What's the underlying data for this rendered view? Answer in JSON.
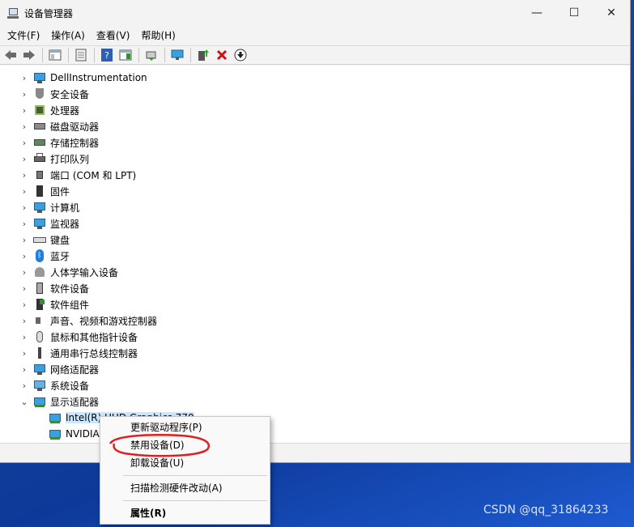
{
  "window": {
    "title": "设备管理器",
    "controls": {
      "minimize": "—",
      "maximize": "☐",
      "close": "✕"
    }
  },
  "menubar": [
    {
      "label": "文件(F)"
    },
    {
      "label": "操作(A)"
    },
    {
      "label": "查看(V)"
    },
    {
      "label": "帮助(H)"
    }
  ],
  "toolbar": {
    "back_icon": "arrow-left-icon",
    "forward_icon": "arrow-right-icon",
    "remove_icon": "red-x-icon",
    "download_icon": "down-arrow-circle-icon"
  },
  "tree": {
    "categories": [
      {
        "label": "DellInstrumentation",
        "icon": "monitor-icon"
      },
      {
        "label": "安全设备",
        "icon": "shield-icon"
      },
      {
        "label": "处理器",
        "icon": "chip-icon"
      },
      {
        "label": "磁盘驱动器",
        "icon": "disk-icon"
      },
      {
        "label": "存储控制器",
        "icon": "storage-icon"
      },
      {
        "label": "打印队列",
        "icon": "printer-icon"
      },
      {
        "label": "端口 (COM 和 LPT)",
        "icon": "port-icon"
      },
      {
        "label": "固件",
        "icon": "firmware-icon"
      },
      {
        "label": "计算机",
        "icon": "computer-icon"
      },
      {
        "label": "监视器",
        "icon": "monitor-icon"
      },
      {
        "label": "键盘",
        "icon": "keyboard-icon"
      },
      {
        "label": "蓝牙",
        "icon": "bluetooth-icon"
      },
      {
        "label": "人体学输入设备",
        "icon": "hid-icon"
      },
      {
        "label": "软件设备",
        "icon": "software-device-icon"
      },
      {
        "label": "软件组件",
        "icon": "software-component-icon"
      },
      {
        "label": "声音、视频和游戏控制器",
        "icon": "speaker-icon"
      },
      {
        "label": "鼠标和其他指针设备",
        "icon": "mouse-icon"
      },
      {
        "label": "通用串行总线控制器",
        "icon": "usb-icon"
      },
      {
        "label": "网络适配器",
        "icon": "network-icon"
      },
      {
        "label": "系统设备",
        "icon": "system-device-icon"
      },
      {
        "label": "显示适配器",
        "icon": "display-adapter-icon",
        "expanded": true
      }
    ],
    "display_children": [
      {
        "label": "Intel(R) UHD Graphics 770",
        "selected": true
      },
      {
        "label": "NVIDIA"
      }
    ]
  },
  "context_menu": {
    "items": [
      {
        "label": "更新驱动程序(P)"
      },
      {
        "label": "禁用设备(D)"
      },
      {
        "label": "卸载设备(U)"
      },
      {
        "label": "扫描检测硬件改动(A)"
      },
      {
        "label": "属性(R)"
      }
    ]
  },
  "annotation_color": "#e02020",
  "watermark": "CSDN @qq_31864233"
}
